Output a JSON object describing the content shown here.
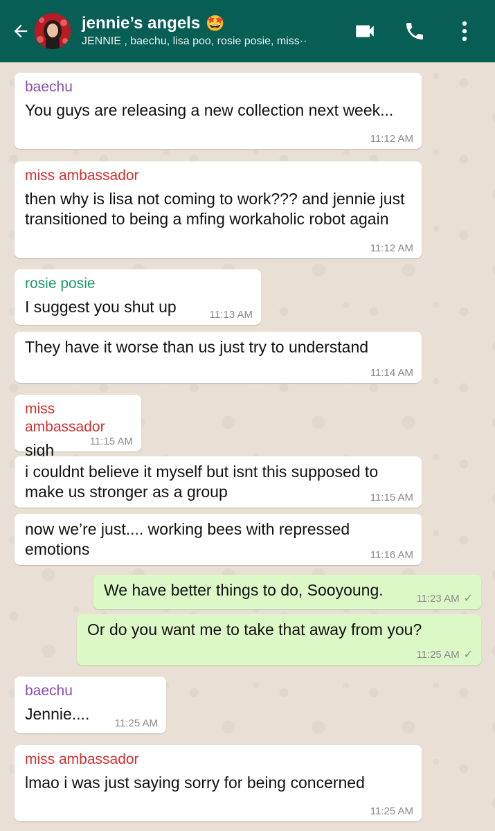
{
  "header": {
    "title": "jennie’s angels",
    "emoji": "🤩",
    "members": "JENNIE , baechu, lisa poo, rosie posie, miss··",
    "icons": [
      "back-arrow-icon",
      "video-call-icon",
      "phone-icon",
      "more-vert-icon"
    ]
  },
  "colors": {
    "header_bg": "#075e54",
    "outgoing_bubble": "#dcf8c6",
    "sender_baechu": "#8a4fb1",
    "sender_miss_ambassador": "#d32f2f",
    "sender_rosie_posie": "#1f9a6a"
  },
  "messages": [
    {
      "sender": "baechu",
      "text": "You guys are releasing a new collection next week...",
      "time": "11:12 AM"
    },
    {
      "sender": "miss ambassador",
      "text": "then why is lisa not coming to work??? and jennie just transitioned to being a mfing workaholic robot again",
      "time": "11:12 AM"
    },
    {
      "sender": "rosie posie",
      "text": "I suggest you shut up",
      "time": "11:13 AM"
    },
    {
      "sender": "",
      "text": "They have it worse than us just try to understand",
      "time": "11:14 AM"
    },
    {
      "sender": "miss ambassador",
      "text": "sigh",
      "time": "11:15 AM"
    },
    {
      "sender": "",
      "text": "i couldnt believe it myself but isnt this supposed to make us stronger as a group",
      "time": "11:15 AM"
    },
    {
      "sender": "",
      "text": "now we’re just.... working bees with repressed emotions",
      "time": "11:16 AM"
    },
    {
      "sender": "",
      "text": "We have better things to do, Sooyoung.",
      "time": "11:23 AM",
      "outgoing": true
    },
    {
      "sender": "",
      "text": "Or do you want me to take that away from you?",
      "time": "11:25 AM",
      "outgoing": true
    },
    {
      "sender": "baechu",
      "text": "Jennie....",
      "time": "11:25 AM"
    },
    {
      "sender": "miss ambassador",
      "text": "lmao i was just saying sorry for being concerned",
      "time": "11:25 AM"
    }
  ]
}
